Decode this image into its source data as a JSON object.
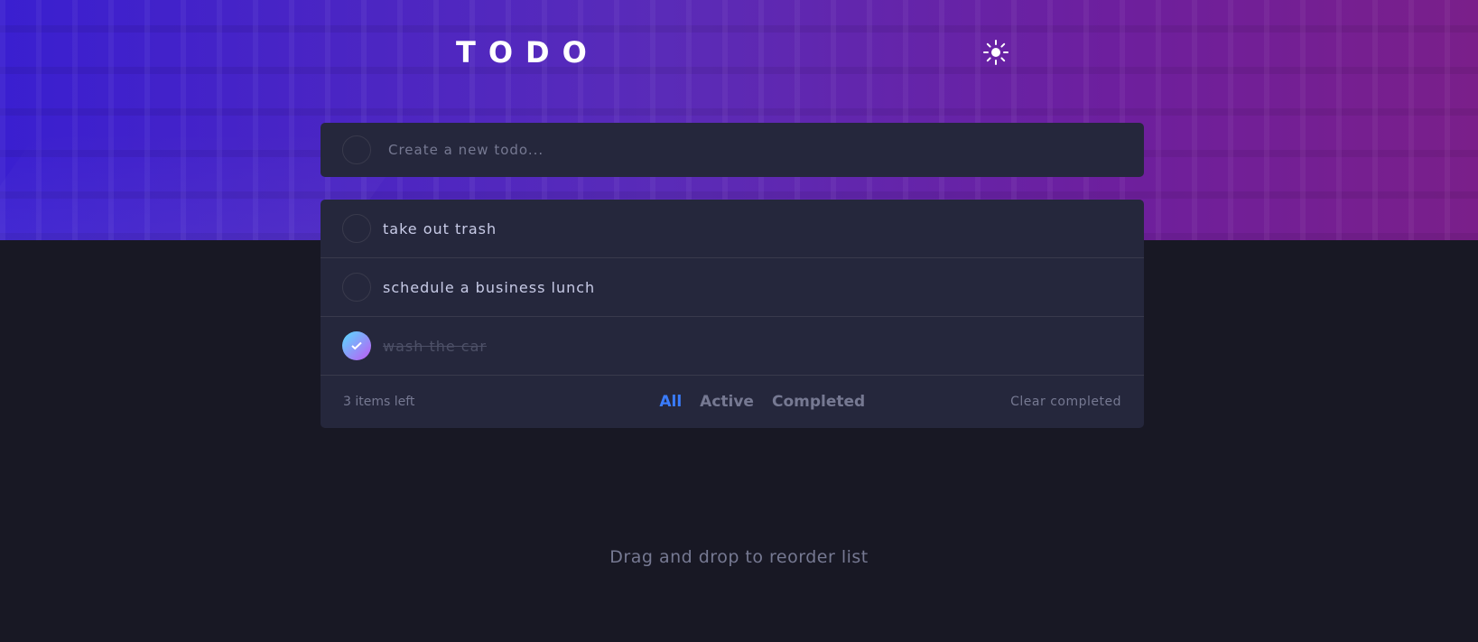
{
  "header": {
    "title": "TODO",
    "theme_icon": "sun-icon"
  },
  "new_todo": {
    "placeholder": "Create a new todo..."
  },
  "todos": [
    {
      "text": "take out trash",
      "completed": false
    },
    {
      "text": "schedule a business lunch",
      "completed": false
    },
    {
      "text": "wash the car",
      "completed": true
    }
  ],
  "footer": {
    "items_left": "3 items left",
    "filters": [
      {
        "label": "All",
        "active": true
      },
      {
        "label": "Active",
        "active": false
      },
      {
        "label": "Completed",
        "active": false
      }
    ],
    "clear_label": "Clear completed"
  },
  "hint": "Drag and drop to reorder list",
  "colors": {
    "background": "#181824",
    "card": "#25273c",
    "accent": "#3a7cfd",
    "check_gradient_start": "#57ddff",
    "check_gradient_end": "#c058f3"
  }
}
